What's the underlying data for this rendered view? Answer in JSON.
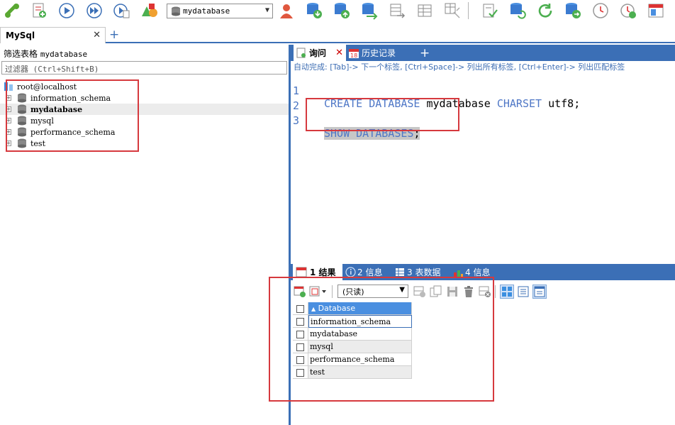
{
  "toolbar": {
    "database_select": "mydatabase",
    "icons": [
      "connect-icon",
      "new-query-icon",
      "execute-icon",
      "execute-all-icon",
      "execute-file-icon",
      "shapes-icon",
      "user-icon",
      "backup-icon",
      "restore-icon",
      "sync-icon",
      "export-icon",
      "import-table-icon",
      "schema-designer-icon",
      "check-icon",
      "refresh-db-icon",
      "refresh-icon",
      "db-export-icon",
      "clock-icon",
      "scheduler-icon",
      "window-icon"
    ]
  },
  "connection_tab": {
    "label": "MySql"
  },
  "left_panel": {
    "title_prefix": "筛选表格",
    "title_db": "mydatabase",
    "filter_placeholder": "过滤器 (Ctrl+Shift+B)",
    "root": "root@localhost",
    "databases": [
      "information_schema",
      "mydatabase",
      "mysql",
      "performance_schema",
      "test"
    ],
    "selected_database": "mydatabase"
  },
  "editor": {
    "tabs": {
      "query": "询问",
      "history": "历史记录"
    },
    "hint": "自动完成: [Tab]-> 下一个标签, [Ctrl+Space]-> 列出所有标签, [Ctrl+Enter]-> 列出匹配标签",
    "lines": {
      "l1_num": "1",
      "l1_kw1": "CREATE DATABASE",
      "l1_name": " mydatabase ",
      "l1_kw2": "CHARSET",
      "l1_tail": " utf8;",
      "l2_num": "2",
      "l3_num": "3",
      "l3_kw": "SHOW DATABASES",
      "l3_tail": ";"
    }
  },
  "results": {
    "tabs": {
      "result": "1 结果",
      "info": "2 信息",
      "table_data": "3 表数据",
      "info4": "4 信息"
    },
    "mode_select": "(只读)",
    "column_header": "Database",
    "rows": [
      "information_schema",
      "mydatabase",
      "mysql",
      "performance_schema",
      "test"
    ]
  },
  "colors": {
    "accent": "#3b6fb6",
    "annotation_red": "#d6393e",
    "keyword": "#4f77c6",
    "header_blue": "#4a8fe0"
  }
}
